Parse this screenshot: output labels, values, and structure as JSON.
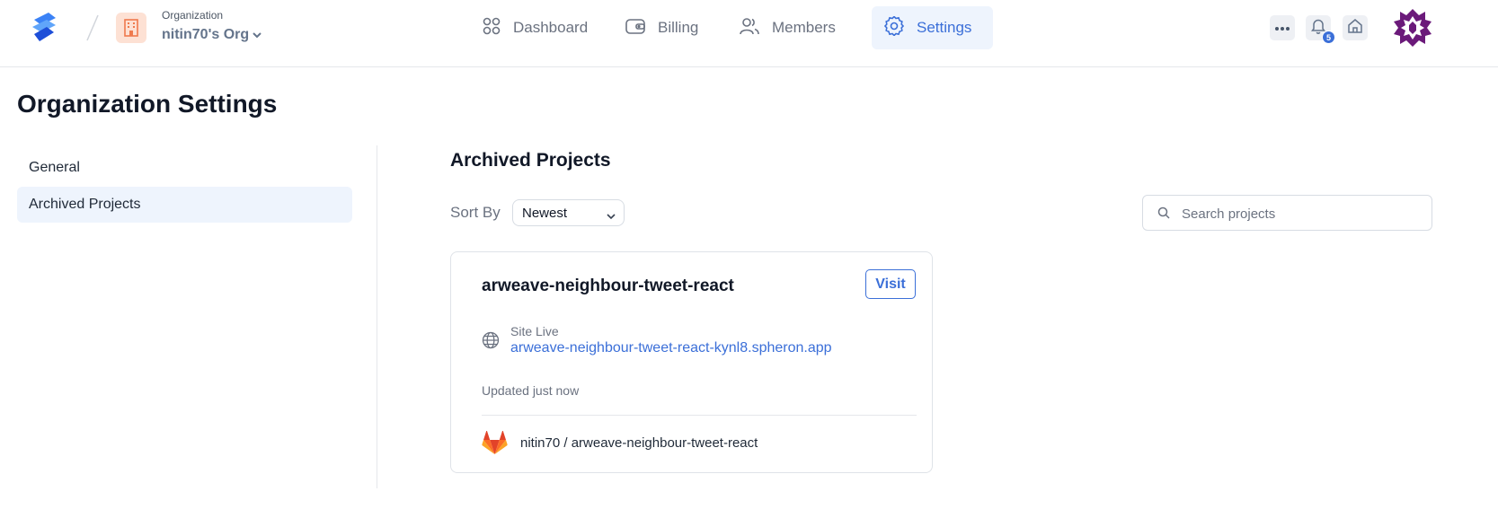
{
  "header": {
    "org_caption": "Organization",
    "org_name": "nitin70's Org",
    "nav": {
      "dashboard": "Dashboard",
      "billing": "Billing",
      "members": "Members",
      "settings": "Settings"
    },
    "notifications_count": "5",
    "accent_color": "#3b6fd8"
  },
  "page": {
    "title": "Organization Settings"
  },
  "sidebar": {
    "items": [
      {
        "label": "General"
      },
      {
        "label": "Archived Projects"
      }
    ]
  },
  "main": {
    "section_title": "Archived Projects",
    "sort_label": "Sort By",
    "sort_value": "Newest",
    "search_placeholder": "Search projects",
    "projects": [
      {
        "name": "arweave-neighbour-tweet-react",
        "visit_label": "Visit",
        "status_label": "Site Live",
        "url": "arweave-neighbour-tweet-react-kynl8.spheron.app",
        "updated": "Updated just now",
        "repo": "nitin70 / arweave-neighbour-tweet-react"
      }
    ]
  }
}
